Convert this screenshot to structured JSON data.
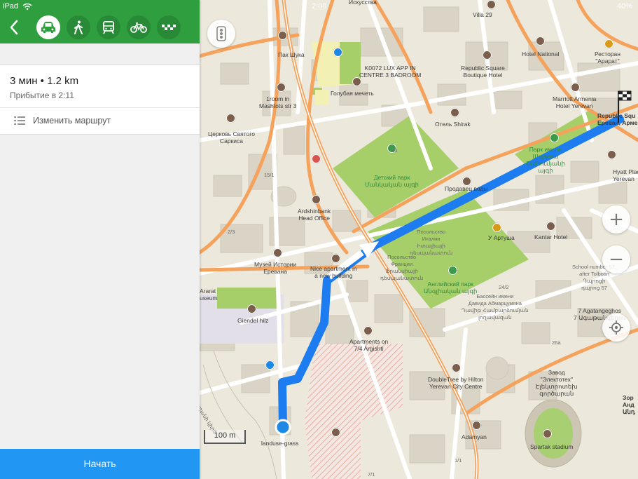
{
  "status_bar": {
    "device": "iPad",
    "time": "2:09",
    "battery": "40%"
  },
  "topbar": {
    "back_label": "<",
    "modes": [
      {
        "name": "car",
        "active": true
      },
      {
        "name": "walk",
        "active": false
      },
      {
        "name": "transit",
        "active": false
      },
      {
        "name": "bike",
        "active": false
      },
      {
        "name": "taxi",
        "active": false
      }
    ]
  },
  "route": {
    "eta": "3 мин • 1.2 km",
    "arrival": "Прибытие в 2:11",
    "change_label": "Изменить маршрут"
  },
  "start_label": "Начать",
  "map": {
    "scale": "100 m",
    "labels": {
      "pak_shuka": "Пак Шука",
      "k0072": "K0072 LUX APP IN\nCENTRE 3 BADROOM",
      "republic_square_hotel": "Republic Square\nBoutique Hotel",
      "hotel_national": "Hotel National",
      "restoran_ararat": "Ресторан\n\"Арарат\"",
      "villa29": "Villa 29",
      "iskusstva": "Искусства",
      "mosque": "Голубая мечеть",
      "oneroom": "1room in\nMashtots str 3",
      "church": "Церковь Святого\nСаркиса",
      "hotel_shirak": "Отель Shirak",
      "marriott": "Marriott Armenia\nHotel Yerevan",
      "republic_sq": "Republic Squ\nЕреван, Армен",
      "park_shaumyan": "Парк имени\nШаумяна\nՇահումյանի\nայգի",
      "detsky_park": "Детский парк\nՄանկական այգի",
      "hyatt": "Hyatt Plac\nYerevan",
      "prodavets": "Продавец воды",
      "ardshinbank": "Ardshinbank\nHead Office",
      "embassy_italy": "Посольство\nИталии\nԻտալիայի\nդեսպանատուն",
      "u_artusha": "У Артуша",
      "kantar_hotel": "Kantar Hotel",
      "muzey": "Музей Истории\nЕревана",
      "nice_apartment": "Nice apartment in\na new building",
      "embassy_france": "Посольство\nФранции\nՖրանսիայի\nդեսպանատուն",
      "angliysky_park": "Английский парк\nԱնգլիական այգի",
      "school57": "School number 57,\nafter Tolbotin\nԴպրոցի\nդպրոց 57",
      "ararat_museum": "Ararat\nuseum",
      "giendel": "Giendel hilz",
      "sculpture": "Бассейн имени\nДавида Абмарцумяна\nԴավիթ Համբարձումյան\nլողավազան",
      "agatangeghos": "7 Agatangeghos\n7 Ագաթանգեղոս",
      "apartments": "Apartments on\n7/4 Argishti",
      "doubletree": "DoubleTree by Hilton\nYerevan City Centre",
      "zavod": "Завод\n\"Электотех\"\nԷլեկտրոտեխ\nգործարան",
      "zor": "Зор\nАнд\nԱնդ",
      "adamyan": "Adamyan",
      "landuse": "landuse-grass",
      "spartak": "Spartak stadium",
      "hrazdan": "Հրազդանի կիրճ",
      "n13": "13",
      "n15_1": "15/1",
      "n2_3": "2/3",
      "n24_2": "24/2",
      "n26a": "26a",
      "n1_1": "1/1",
      "n7_1": "7/1"
    }
  },
  "colors": {
    "topbar": "#2e9e3e",
    "route": "#1c7cf0",
    "start_button": "#2196f3",
    "park": "#a6cf6a",
    "road_major": "#f5a25c"
  }
}
